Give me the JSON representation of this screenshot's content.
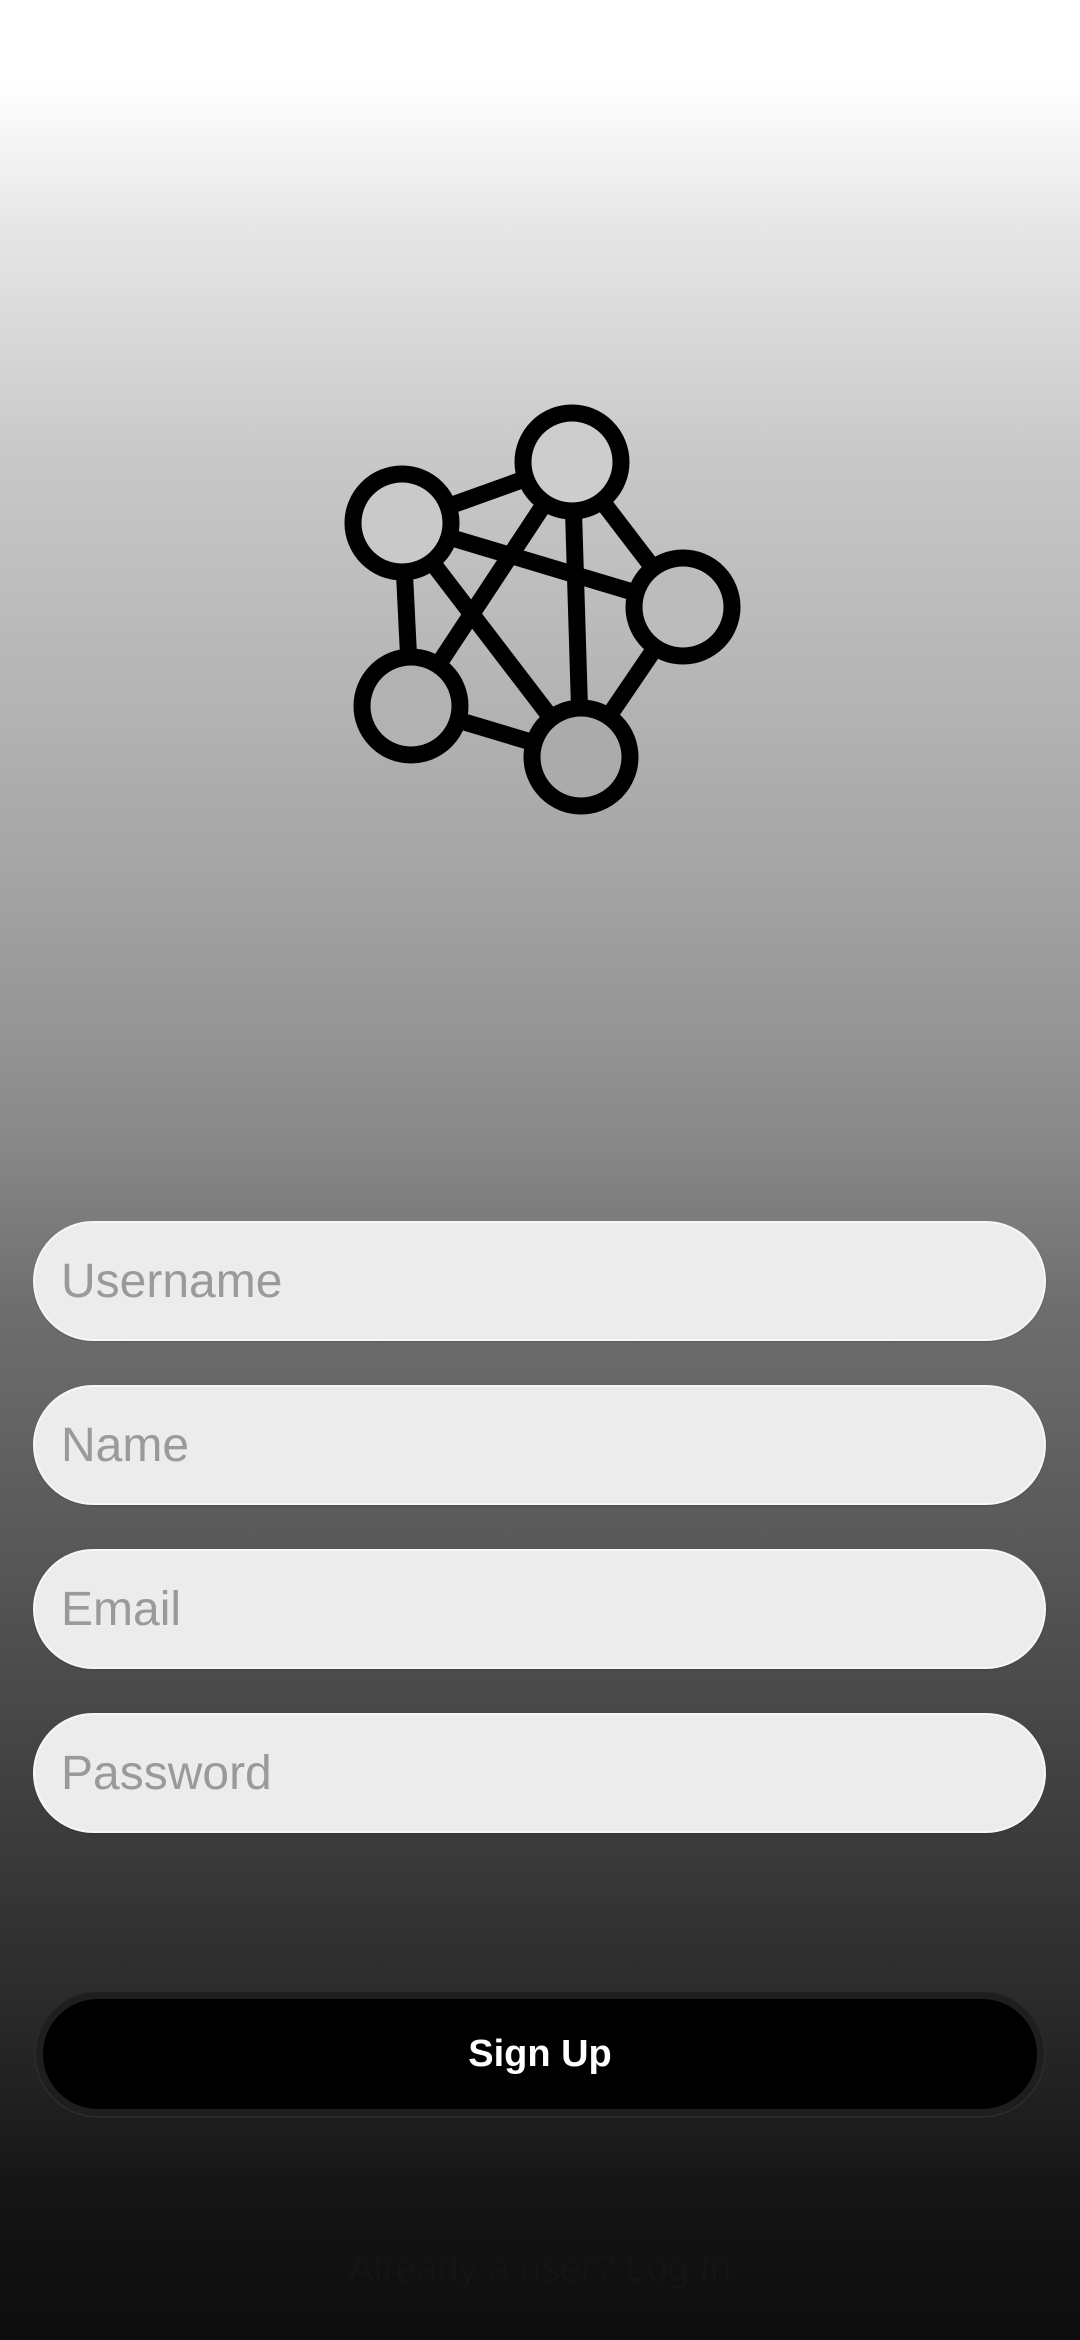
{
  "logo": {
    "icon": "network-nodes-icon"
  },
  "form": {
    "username_placeholder": "Username",
    "name_placeholder": "Name",
    "email_placeholder": "Email",
    "password_placeholder": "Password"
  },
  "signup": {
    "button_label": "Sign Up"
  },
  "footer": {
    "prompt": "Already a user?",
    "login_link": "Log In"
  },
  "colors": {
    "button_background": "#000000",
    "button_text": "#ffffff",
    "field_background": "#ececec",
    "placeholder_text": "#9a9a9a"
  }
}
